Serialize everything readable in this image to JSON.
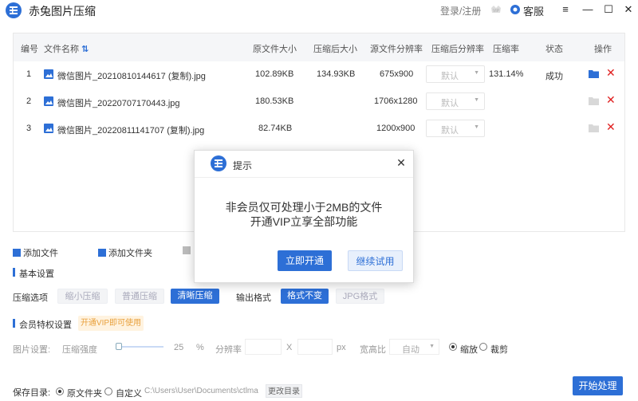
{
  "app": {
    "title": "赤兔图片压缩",
    "login": "登录/注册",
    "customer_service": "客服"
  },
  "table": {
    "headers": [
      "编号",
      "文件名称",
      "原文件大小",
      "压缩后大小",
      "源文件分辨率",
      "压缩后分辨率",
      "压缩率",
      "状态",
      "操作"
    ],
    "rows": [
      {
        "index": "1",
        "name": "微信图片_20210810144617 (复制).jpg",
        "orig_size": "102.89KB",
        "comp_size": "134.93KB",
        "src_res": "675x900",
        "res_select": "默认",
        "ratio": "131.14%",
        "status": "成功",
        "active": true
      },
      {
        "index": "2",
        "name": "微信图片_20220707170443.jpg",
        "orig_size": "180.53KB",
        "comp_size": "",
        "src_res": "1706x1280",
        "res_select": "默认",
        "ratio": "",
        "status": "",
        "active": false
      },
      {
        "index": "3",
        "name": "微信图片_20220811141707 (复制).jpg",
        "orig_size": "82.74KB",
        "comp_size": "",
        "src_res": "1200x900",
        "res_select": "默认",
        "ratio": "",
        "status": "",
        "active": false
      }
    ]
  },
  "actions": {
    "add_file": "添加文件",
    "add_folder": "添加文件夹"
  },
  "basic": {
    "title": "基本设置",
    "compress_label": "压缩选项",
    "compress_options": [
      "缩小压缩",
      "普通压缩",
      "清晰压缩"
    ],
    "compress_selected": "清晰压缩",
    "format_label": "输出格式",
    "format_options": [
      "格式不变",
      "JPG格式"
    ],
    "format_selected": "格式不变"
  },
  "vip": {
    "title": "会员特权设置",
    "tag": "开通VIP即可使用",
    "image_settings_label": "图片设置:",
    "strength_label": "压缩强度",
    "strength_value": "25",
    "strength_unit": "%",
    "resolution_label": "分辨率",
    "x_sep": "X",
    "px_unit": "px",
    "aspect_label": "宽高比",
    "aspect_value": "自动",
    "scale_label": "缩放",
    "crop_label": "裁剪"
  },
  "save": {
    "label": "保存目录:",
    "original_folder": "原文件夹",
    "custom": "自定义",
    "path": "C:\\Users\\User\\Documents\\ctlma",
    "change_dir": "更改目录",
    "start": "开始处理"
  },
  "modal": {
    "title": "提示",
    "line1": "非会员仅可处理小于2MB的文件",
    "line2": "开通VIP立享全部功能",
    "primary": "立即开通",
    "secondary": "继续试用"
  },
  "colors": {
    "accent": "#2d6fd6",
    "danger": "#e02020",
    "vip_tag": "#e8a03c"
  }
}
